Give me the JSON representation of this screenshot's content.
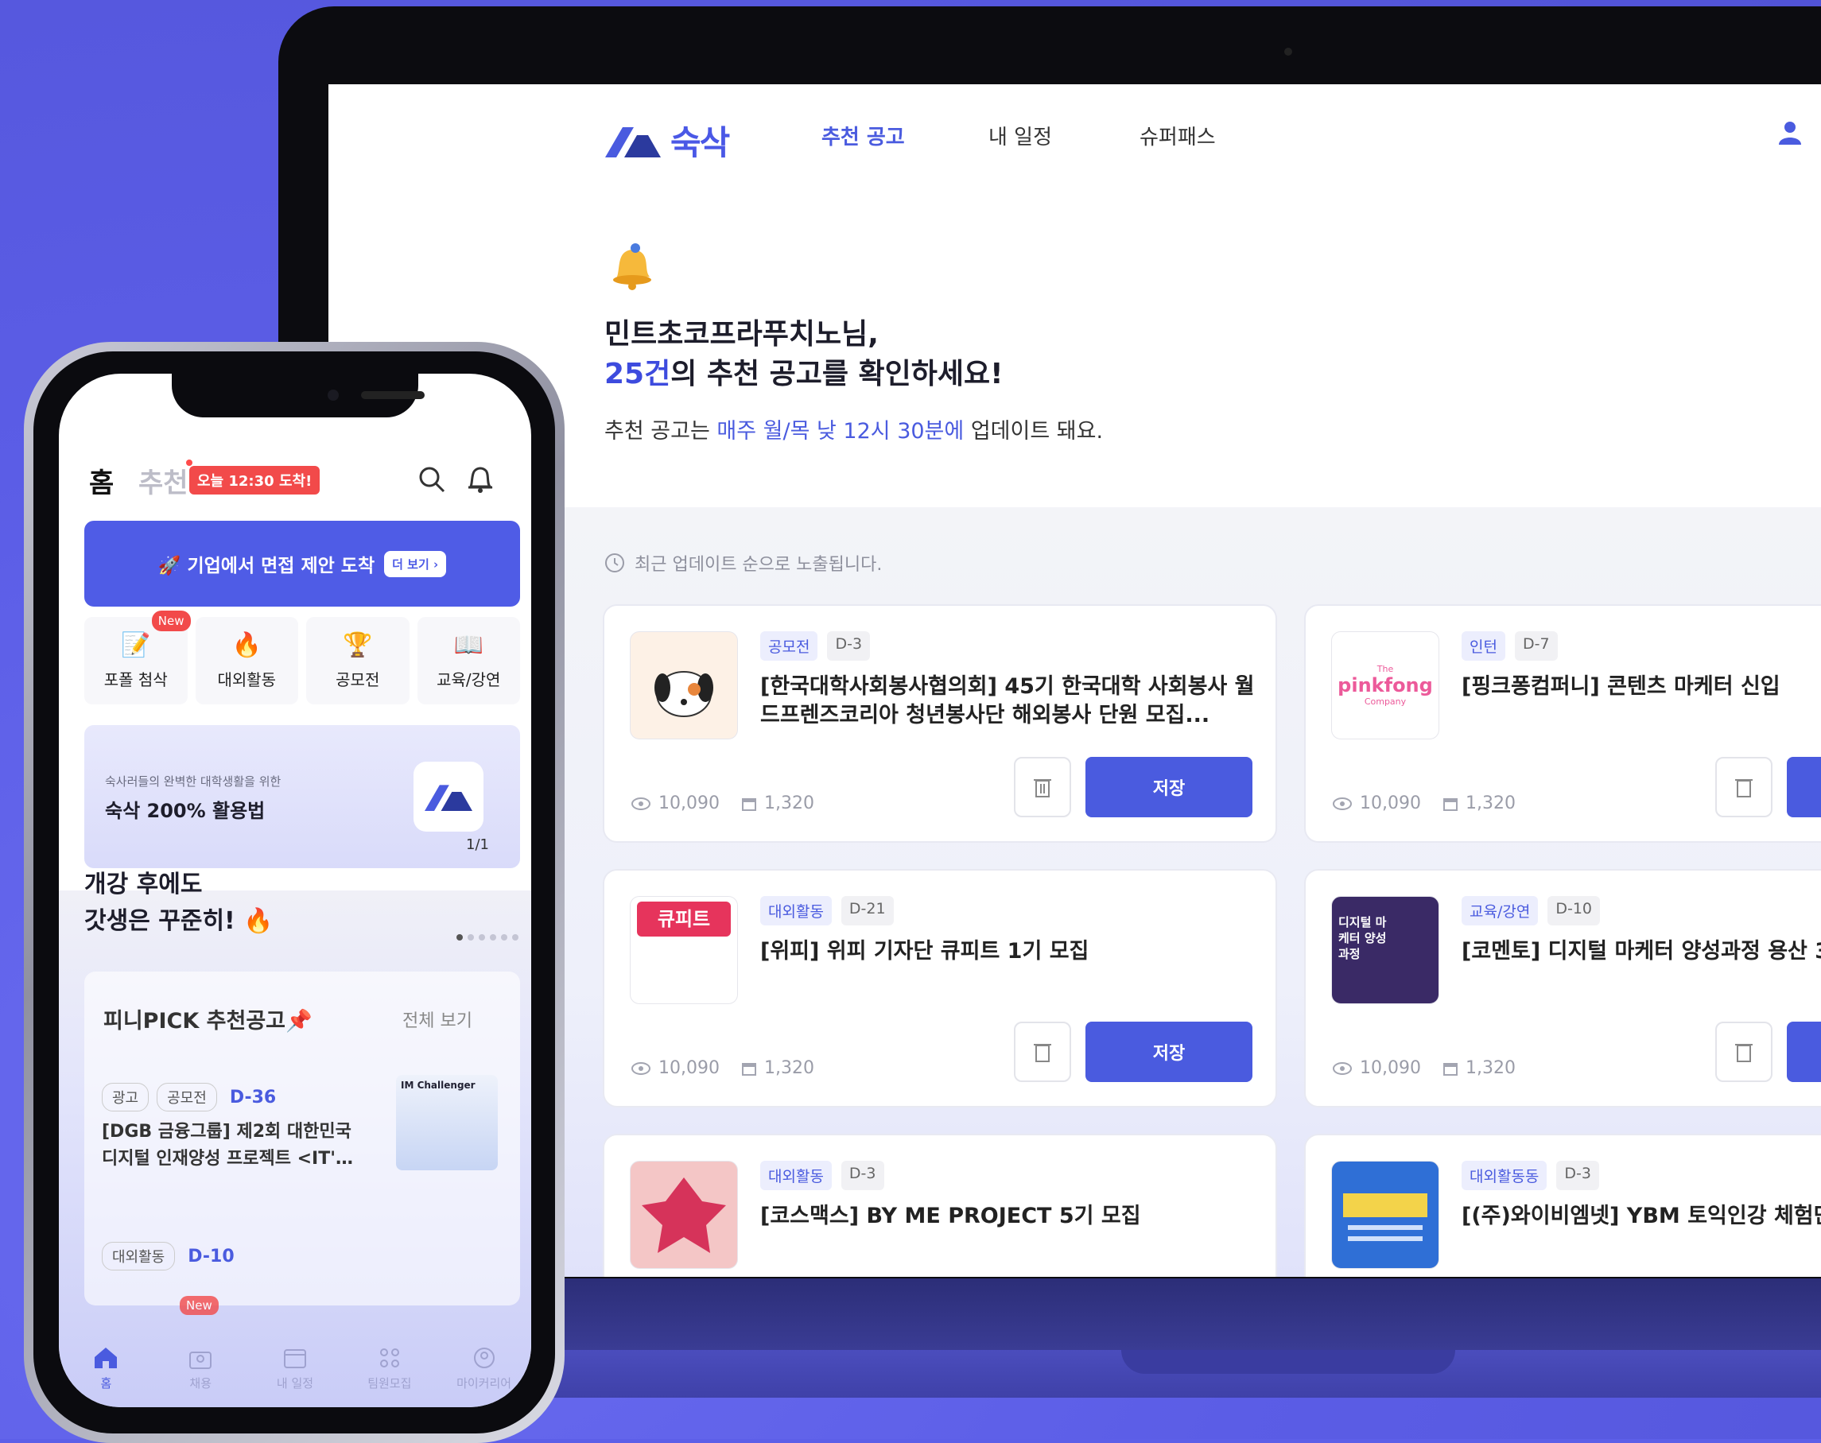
{
  "web": {
    "logo_text": "숙삭",
    "nav": [
      "추천 공고",
      "내 일정",
      "슈퍼패스"
    ],
    "greeting_line1": "민트초코프라푸치노님,",
    "greeting_count": "25건",
    "greeting_rest": "의 추천 공고를 확인하세요!",
    "sub_prefix": "추천 공고는 ",
    "sub_accent": "매주 월/목 낮 12시 30분에",
    "sub_suffix": " 업데이트 돼요.",
    "hint": "최근 업데이트 순으로 노출됩니다.",
    "save_label": "저장",
    "cards": [
      {
        "tag": "공모전",
        "dday": "D-3",
        "title": "[한국대학사회봉사협의회] 45기 한국대학 사회봉사 월드프렌즈코리아 청년봉사단 해외봉사 단원 모집...",
        "views": "10,090",
        "saves": "1,320"
      },
      {
        "tag": "인턴",
        "dday": "D-7",
        "title": "[핑크퐁컴퍼니] 콘텐츠 마케터 신입",
        "views": "10,090",
        "saves": "1,320"
      },
      {
        "tag": "대외활동",
        "dday": "D-21",
        "title": "[위피] 위피 기자단 큐피트 1기 모집",
        "views": "10,090",
        "saves": "1,320"
      },
      {
        "tag": "교육/강연",
        "dday": "D-10",
        "title": "[코멘토] 디지털 마케터 양성과정 용산 3",
        "views": "10,090",
        "saves": "1,320"
      },
      {
        "tag": "대외활동",
        "dday": "D-3",
        "title": "[코스맥스] BY ME PROJECT 5기 모집"
      },
      {
        "tag": "대외활동동",
        "dday": "D-3",
        "title": "[(주)와이비엠넷] YBM 토익인강 체험단 즈 모집"
      }
    ],
    "thumb_texts": {
      "pinkfong_the": "The",
      "pinkfong": "pinkfong",
      "pinkfong_company": "Company",
      "cupid": "큐피트",
      "digital": "디지털 마케터 양성과정"
    }
  },
  "phone": {
    "home": "홈",
    "recommend": "추천",
    "arrive_badge": "오늘 12:30 도착!",
    "banner": "🚀 기업에서 면접 제안 도착",
    "banner_more": "더 보기 ›",
    "cats": [
      {
        "icon": "📝",
        "label": "포폴 첨삭"
      },
      {
        "icon": "🔥",
        "label": "대외활동"
      },
      {
        "icon": "🏆",
        "label": "공모전"
      },
      {
        "icon": "📖",
        "label": "교육/강연"
      }
    ],
    "new_badge": "New",
    "promo_small": "숙사러들의 완벽한 대학생활을 위한",
    "promo_big": "숙삭 200% 활용법",
    "promo_pager": "1/1",
    "headline1": "개강 후에도",
    "headline2": "갓생은 꾸준히! 🔥",
    "pick_title": "피니PICK 추천공고📌",
    "pick_all": "전체 보기",
    "pick_tag1": "광고",
    "pick_tag2": "공모전",
    "pick_dday": "D-36",
    "pick_item": "[DGB 금융그룹] 제2회 대한민국 디지털 인재양성 프로젝트 <IT'…",
    "pick_thumb_text": "IM Challenger",
    "pick2_tag": "대외활동",
    "pick2_dday": "D-10",
    "tabs": [
      "홈",
      "채용",
      "내 일정",
      "팀원모집",
      "마이커리어"
    ]
  }
}
